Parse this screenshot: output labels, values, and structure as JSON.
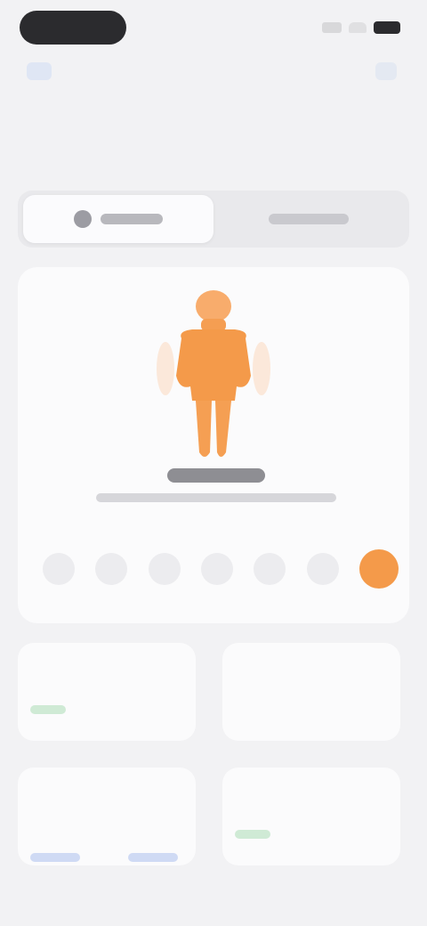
{
  "page": {
    "title": ""
  },
  "segments": [
    {
      "label": "",
      "icon": "body-icon",
      "active": true
    },
    {
      "label": "",
      "icon": "list-icon",
      "active": false
    }
  ],
  "body_map": {
    "figure": "human-front",
    "highlight_color": "#f49a4a",
    "label": "",
    "subtitle": ""
  },
  "days": [
    {
      "label": "",
      "active": false
    },
    {
      "label": "",
      "active": false
    },
    {
      "label": "",
      "active": false
    },
    {
      "label": "",
      "active": false
    },
    {
      "label": "",
      "active": false
    },
    {
      "label": "",
      "active": false
    },
    {
      "label": "",
      "active": true
    }
  ],
  "stats": [
    {
      "label": "",
      "value": "",
      "trend": "green"
    },
    {
      "label": "",
      "value": "",
      "trend": "none"
    },
    {
      "label": "",
      "value": "",
      "trend": "none"
    },
    {
      "label": "",
      "value": "",
      "trend": "green"
    }
  ],
  "colors": {
    "accent": "#f49a4a",
    "background": "#f2f2f4",
    "card": "#fbfbfc"
  }
}
